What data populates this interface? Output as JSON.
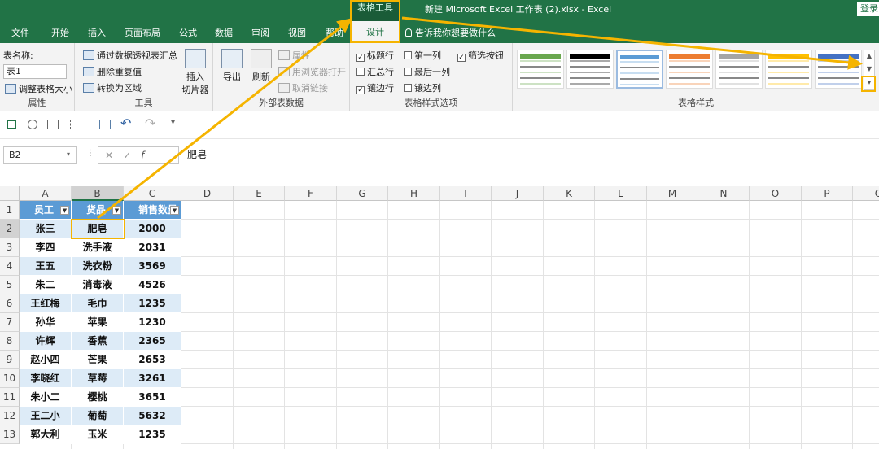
{
  "window": {
    "context_tab_label": "表格工具",
    "title": "新建 Microsoft Excel 工作表 (2).xlsx  -  Excel",
    "login_label": "登录"
  },
  "ribbon_tabs": [
    "文件",
    "开始",
    "插入",
    "页面布局",
    "公式",
    "数据",
    "审阅",
    "视图",
    "帮助"
  ],
  "active_tab": "设计",
  "tell_me": "告诉我你想要做什么",
  "groups": {
    "properties": {
      "label": "属性",
      "table_name_label": "表名称:",
      "table_name_value": "表1",
      "resize_label": "调整表格大小"
    },
    "tools": {
      "label": "工具",
      "pivot_label": "通过数据透视表汇总",
      "remove_dup_label": "删除重复值",
      "convert_label": "转换为区域",
      "slicer_label_1": "插入",
      "slicer_label_2": "切片器"
    },
    "external": {
      "label": "外部表数据",
      "export_label": "导出",
      "refresh_label": "刷新",
      "properties_label": "属性",
      "open_browser_label": "用浏览器打开",
      "unlink_label": "取消链接"
    },
    "style_options": {
      "label": "表格样式选项",
      "header_row": "标题行",
      "total_row": "汇总行",
      "banded_rows": "镶边行",
      "first_column": "第一列",
      "last_column": "最后一列",
      "banded_columns": "镶边列",
      "filter_button": "筛选按钮",
      "checked": {
        "header_row": true,
        "total_row": false,
        "banded_rows": true,
        "first_column": false,
        "last_column": false,
        "banded_columns": false,
        "filter_button": true
      }
    },
    "styles": {
      "label": "表格样式",
      "swatch_colors": [
        "#6aa84f",
        "#000000",
        "#5b9bd5",
        "#ed7d31",
        "#a5a5a5",
        "#ffc000",
        "#4472c4"
      ]
    }
  },
  "formula_bar": {
    "cell_ref": "B2",
    "value": "肥皂"
  },
  "columns": [
    "A",
    "B",
    "C",
    "D",
    "E",
    "F",
    "G",
    "H",
    "I",
    "J",
    "K",
    "L",
    "M",
    "N",
    "O",
    "P",
    "Q"
  ],
  "row_numbers": [
    "1",
    "2",
    "3",
    "4",
    "5",
    "6",
    "7",
    "8",
    "9",
    "10",
    "11",
    "12",
    "13"
  ],
  "table": {
    "headers": [
      "员工",
      "货品",
      "销售数量"
    ],
    "rows": [
      [
        "张三",
        "肥皂",
        "2000"
      ],
      [
        "李四",
        "洗手液",
        "2031"
      ],
      [
        "王五",
        "洗衣粉",
        "3569"
      ],
      [
        "朱二",
        "消毒液",
        "4526"
      ],
      [
        "王红梅",
        "毛巾",
        "1235"
      ],
      [
        "孙华",
        "苹果",
        "1230"
      ],
      [
        "许辉",
        "香蕉",
        "2365"
      ],
      [
        "赵小四",
        "芒果",
        "2653"
      ],
      [
        "李晓红",
        "草莓",
        "3261"
      ],
      [
        "朱小二",
        "樱桃",
        "3651"
      ],
      [
        "王二小",
        "葡萄",
        "5632"
      ],
      [
        "郭大利",
        "玉米",
        "1235"
      ]
    ]
  },
  "colors": {
    "excel_green": "#217346",
    "table_header": "#5b9bd5",
    "band": "#ddebf7",
    "highlight": "#f5b400"
  }
}
